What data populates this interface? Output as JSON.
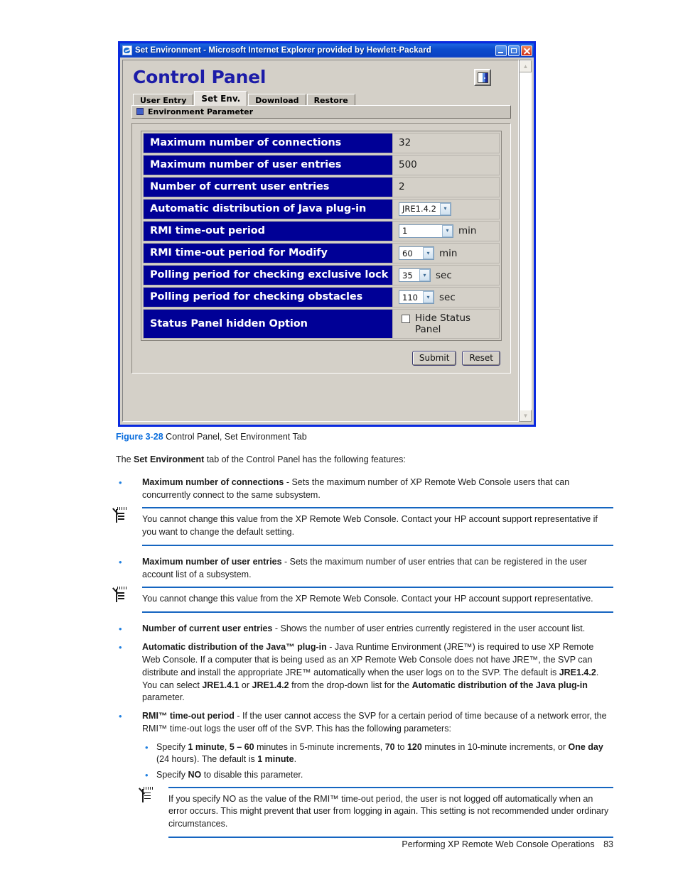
{
  "browser": {
    "title": "Set Environment - Microsoft Internet Explorer provided by Hewlett-Packard",
    "minimize_label": "Minimize",
    "maximize_label": "Maximize",
    "close_label": "Close",
    "scroll_up": "▲",
    "scroll_down": "▼"
  },
  "app": {
    "title": "Control Panel",
    "exit_button_label": "Exit",
    "tabs": [
      {
        "label": "User Entry",
        "active": false
      },
      {
        "label": "Set Env.",
        "active": true
      },
      {
        "label": "Download",
        "active": false
      },
      {
        "label": "Restore",
        "active": false
      }
    ],
    "section_title": "Environment Parameter",
    "parameters": [
      {
        "name": "Maximum number of connections",
        "control": "text",
        "value": "32",
        "unit": ""
      },
      {
        "name": "Maximum number of user entries",
        "control": "text",
        "value": "500",
        "unit": ""
      },
      {
        "name": "Number of current user entries",
        "control": "text",
        "value": "2",
        "unit": ""
      },
      {
        "name": "Automatic distribution of Java plug-in",
        "control": "select-jre",
        "value": "JRE1.4.2",
        "unit": ""
      },
      {
        "name": "RMI time-out period",
        "control": "select-wide",
        "value": "1",
        "unit": "min"
      },
      {
        "name": "RMI time-out period for Modify",
        "control": "select-md",
        "value": "60",
        "unit": "min"
      },
      {
        "name": "Polling period for checking exclusive lock",
        "control": "select-sm",
        "value": "35",
        "unit": "sec"
      },
      {
        "name": "Polling period for checking obstacles",
        "control": "select-md",
        "value": "110",
        "unit": "sec"
      },
      {
        "name": "Status Panel hidden Option",
        "control": "checkbox",
        "value": "Hide Status Panel",
        "unit": ""
      }
    ],
    "dropdown_arrow": "▾",
    "submit_label": "Submit",
    "reset_label": "Reset"
  },
  "document": {
    "figure_number": "Figure 3-28",
    "figure_caption": "Control Panel, Set Environment Tab",
    "intro_before": "The ",
    "intro_bold": "Set Environment",
    "intro_after": " tab of the Control Panel has the following features:",
    "bullet_char": "•",
    "items": [
      {
        "kind": "bullet",
        "bold": "Maximum number of connections",
        "text": " - Sets the maximum number of XP Remote Web Console users that can concurrently connect to the same subsystem."
      },
      {
        "kind": "note",
        "text": "You cannot change this value from the XP Remote Web Console. Contact your HP account support representative if you want to change the default setting."
      },
      {
        "kind": "bullet",
        "bold": "Maximum number of user entries",
        "text": " - Sets the maximum number of user entries that can be registered in the user account list of a subsystem."
      },
      {
        "kind": "note",
        "text": "You cannot change this value from the XP Remote Web Console. Contact your HP account support representative."
      },
      {
        "kind": "bullet",
        "bold": "Number of current user entries",
        "text": " - Shows the number of user entries currently registered in the user account list."
      }
    ],
    "java_bullet": {
      "bold": "Automatic distribution of the Java™ plug-in",
      "p1": " - Java Runtime Environment (JRE™) is required to use XP Remote Web Console. If a computer that is being used as an XP Remote Web Console does not have JRE™, the SVP can distribute and install the appropriate JRE™ automatically when the user logs on to the SVP. The default is ",
      "b1": "JRE1.4.2",
      "p2": ". You can select ",
      "b2": "JRE1.4.1",
      "p3": " or ",
      "b3": "JRE1.4.2",
      "p4": " from the drop-down list for the ",
      "b4": "Automatic distribution of the Java plug-in",
      "p5": " parameter."
    },
    "rmi_bullet": {
      "bold": "RMI™ time-out period",
      "text": " - If the user cannot access the SVP for a certain period of time because of a network error, the RMI™ time-out logs the user off of the SVP. This has the following parameters:"
    },
    "rmi_sub1": {
      "p1": "Specify ",
      "b1": "1 minute",
      "p2": ", ",
      "b2": "5 – 60",
      "p3": " minutes in 5-minute increments, ",
      "b3": "70",
      "p4": " to ",
      "b4": "120",
      "p5": " minutes in 10-minute increments, or ",
      "b5": "One day",
      "p6": " (24 hours). The default is ",
      "b6": "1 minute",
      "p7": "."
    },
    "rmi_sub2": {
      "p1": "Specify ",
      "b1": "NO",
      "p2": " to disable this parameter."
    },
    "final_note": "If you specify NO as the value of the RMI™ time-out period, the user is not logged off automatically when an error occurs. This might prevent that user from logging in again. This setting is not recommended under ordinary circumstances.",
    "footer_text": "Performing XP Remote Web Console Operations",
    "page_number": "83"
  },
  "colors": {
    "title_bar_blue": "#0a4ccd",
    "window_border": "#0a2ae0",
    "param_label_navy": "#000096",
    "heading_blue": "#1c1ca8",
    "figure_link_blue": "#0a6ddd",
    "note_rule_blue": "#1565c0",
    "chrome_gray": "#d4d0c8"
  }
}
